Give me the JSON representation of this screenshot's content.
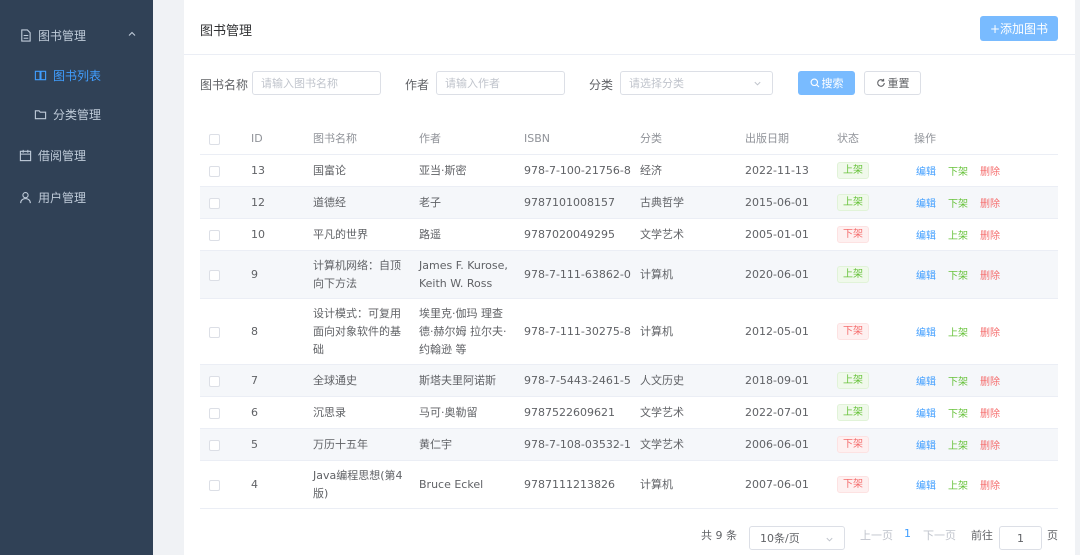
{
  "sidebar": {
    "book_management": "图书管理",
    "book_list": "图书列表",
    "category_management": "分类管理",
    "borrow_management": "借阅管理",
    "user_management": "用户管理"
  },
  "header": {
    "title": "图书管理",
    "add_button": "+添加图书"
  },
  "search": {
    "name_label": "图书名称",
    "name_placeholder": "请输入图书名称",
    "author_label": "作者",
    "author_placeholder": "请输入作者",
    "category_label": "分类",
    "category_placeholder": "请选择分类",
    "search_button": "搜索",
    "reset_button": "重置"
  },
  "table": {
    "columns": [
      "ID",
      "图书名称",
      "作者",
      "ISBN",
      "分类",
      "出版日期",
      "状态",
      "操作"
    ],
    "rows": [
      {
        "id": "13",
        "name": "国富论",
        "author": "亚当·斯密",
        "isbn": "978-7-100-21756-8",
        "category": "经济",
        "date": "2022-11-13",
        "status": "上架",
        "toggle": "下架"
      },
      {
        "id": "12",
        "name": "道德经",
        "author": "老子",
        "isbn": "9787101008157",
        "category": "古典哲学",
        "date": "2015-06-01",
        "status": "上架",
        "toggle": "下架"
      },
      {
        "id": "10",
        "name": "平凡的世界",
        "author": "路遥",
        "isbn": "9787020049295",
        "category": "文学艺术",
        "date": "2005-01-01",
        "status": "下架",
        "toggle": "上架"
      },
      {
        "id": "9",
        "name": "计算机网络：自顶向下方法",
        "author": "James F. Kurose, Keith W. Ross",
        "isbn": "978-7-111-63862-0",
        "category": "计算机",
        "date": "2020-06-01",
        "status": "上架",
        "toggle": "下架"
      },
      {
        "id": "8",
        "name": "设计模式：可复用面向对象软件的基础",
        "author": "埃里克·伽玛 理查德·赫尔姆 拉尔夫·约翰逊 等",
        "isbn": "978-7-111-30275-8",
        "category": "计算机",
        "date": "2012-05-01",
        "status": "下架",
        "toggle": "上架"
      },
      {
        "id": "7",
        "name": "全球通史",
        "author": "斯塔夫里阿诺斯",
        "isbn": "978-7-5443-2461-5",
        "category": "人文历史",
        "date": "2018-09-01",
        "status": "上架",
        "toggle": "下架"
      },
      {
        "id": "6",
        "name": "沉思录",
        "author": "马可·奥勒留",
        "isbn": "9787522609621",
        "category": "文学艺术",
        "date": "2022-07-01",
        "status": "上架",
        "toggle": "下架"
      },
      {
        "id": "5",
        "name": "万历十五年",
        "author": "黄仁宇",
        "isbn": "978-7-108-03532-1",
        "category": "文学艺术",
        "date": "2006-06-01",
        "status": "下架",
        "toggle": "上架"
      },
      {
        "id": "4",
        "name": "Java编程思想(第4版)",
        "author": "Bruce Eckel",
        "isbn": "9787111213826",
        "category": "计算机",
        "date": "2007-06-01",
        "status": "下架",
        "toggle": "上架"
      }
    ],
    "edit_label": "编辑",
    "delete_label": "删除"
  },
  "pagination": {
    "total": "共 9 条",
    "page_size": "10条/页",
    "prev": "上一页",
    "current_page": "1",
    "next": "下一页",
    "goto_prefix": "前往",
    "goto_value": "1",
    "goto_suffix": "页"
  },
  "colors": {
    "sidebar_bg": "#304156",
    "primary": "#409eff",
    "success": "#67c23a",
    "danger": "#f56c6c"
  }
}
